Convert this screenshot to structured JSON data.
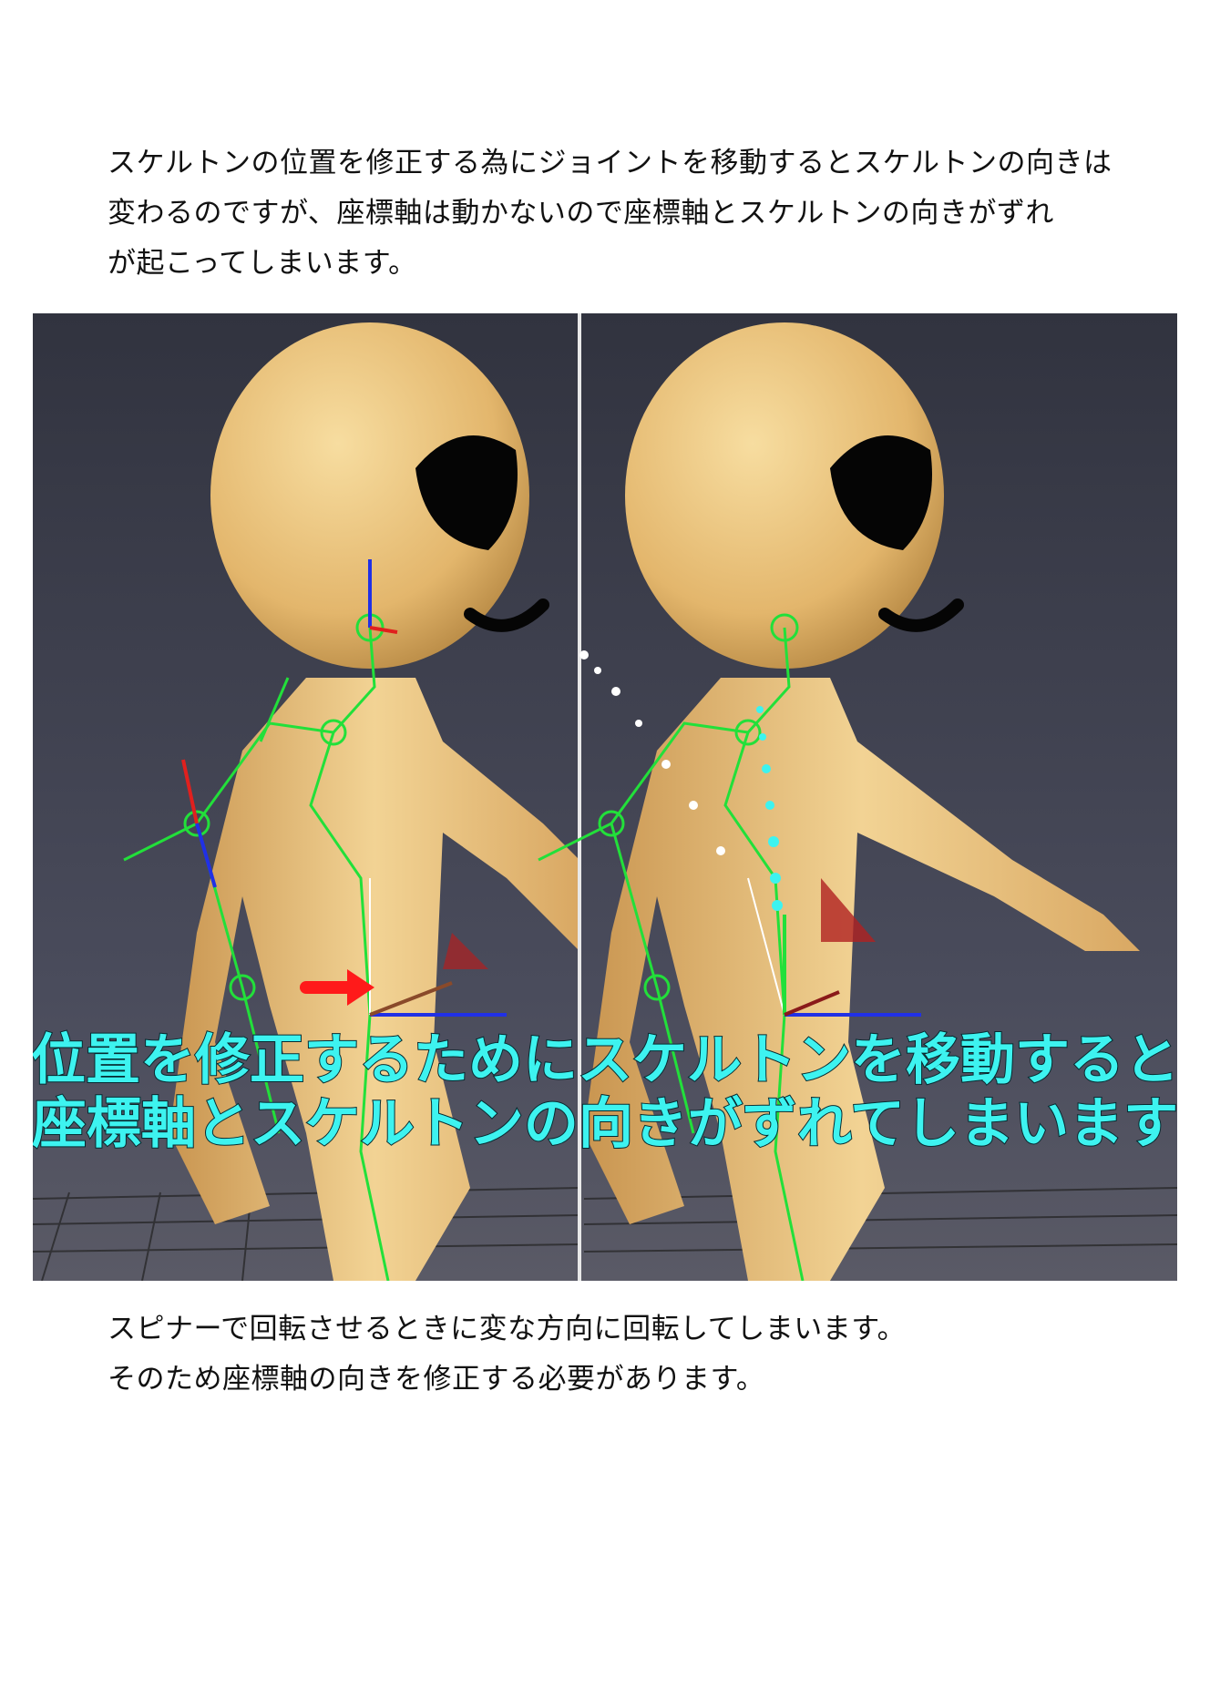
{
  "intro_paragraph": {
    "lines": [
      "スケルトンの位置を修正する為にジョイントを移動するとスケルトンの向きは",
      "変わるのですが、座標軸は動かないので座標軸とスケルトンの向きがずれ",
      "が起こってしまいます。"
    ]
  },
  "figure": {
    "caption_lines": [
      "位置を修正するためにスケルトンを移動すると",
      "座標軸とスケルトンの向きがずれてしまいます"
    ],
    "panels": [
      "before",
      "after"
    ],
    "colors": {
      "background": "#3a3c4c",
      "character_skin": "#e9c27e",
      "bone_green": "#22e03a",
      "axis_red": "#e0201e",
      "axis_blue": "#2030e6",
      "caption_cyan": "#3df3f0",
      "arrow_red": "#ff1a1a"
    }
  },
  "outro_paragraph": {
    "lines": [
      "スピナーで回転させるときに変な方向に回転してしまいます。",
      "そのため座標軸の向きを修正する必要があります。"
    ]
  }
}
